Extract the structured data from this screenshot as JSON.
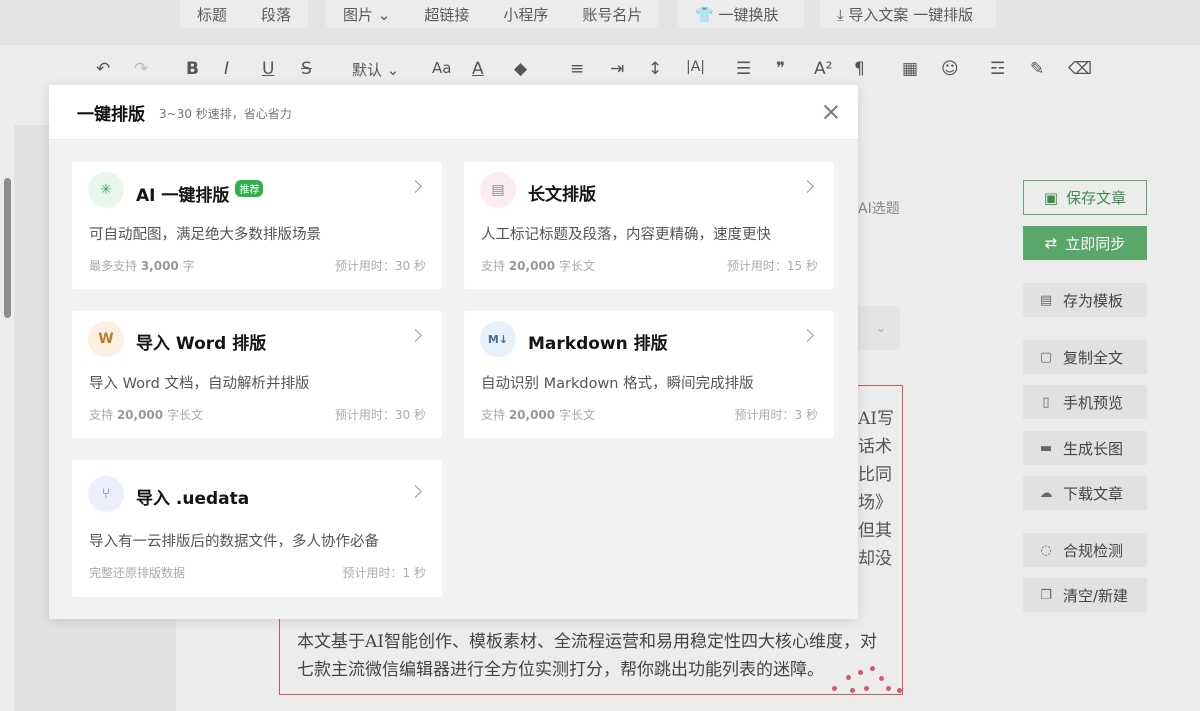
{
  "topbar": {
    "items": [
      {
        "label": "标题"
      },
      {
        "label": "段落"
      },
      {
        "label": "图片 ⌄"
      },
      {
        "label": "超链接"
      },
      {
        "label": "小程序"
      },
      {
        "label": "账号名片"
      },
      {
        "label": "一键换肤"
      },
      {
        "label": "导入文案 一键排版"
      }
    ]
  },
  "toolbar": {
    "font_select": "默认",
    "icons": [
      "undo-icon",
      "redo-icon",
      "bold-icon",
      "italic-icon",
      "underline-icon",
      "strikethrough-icon",
      "font-select",
      "font-size-icon",
      "font-color-icon",
      "highlight-icon",
      "align-icon",
      "indent-icon",
      "line-height-icon",
      "letter-spacing-icon",
      "list-icon",
      "quote-icon",
      "superscript-icon",
      "paragraph-icon",
      "table-icon",
      "emoji-icon",
      "divider-icon",
      "format-painter-icon",
      "eraser-icon"
    ]
  },
  "editor": {
    "ai_topic": "AI选题",
    "side_fragments": [
      "AI写",
      "话术",
      "比同",
      "场》",
      "但其",
      "却没"
    ],
    "body_lines": [
      "本文基于AI智能创作、模板素材、全流程运营和易用稳定性四大核心维度，对",
      "七款主流微信编辑器进行全方位实测打分，帮你跳出功能列表的迷障。"
    ]
  },
  "actions": {
    "save": "保存文章",
    "sync": "立即同步",
    "items": [
      {
        "label": "存为模板",
        "icon": "template-icon"
      },
      {
        "label": "复制全文",
        "icon": "copy-icon"
      },
      {
        "label": "手机预览",
        "icon": "phone-icon"
      },
      {
        "label": "生成长图",
        "icon": "long-image-icon"
      },
      {
        "label": "下载文章",
        "icon": "download-icon"
      },
      {
        "label": "合规检测",
        "icon": "compliance-icon"
      },
      {
        "label": "清空/新建",
        "icon": "clear-icon"
      }
    ]
  },
  "modal": {
    "title": "一键排版",
    "subtitle": "3~30 秒速排，省心省力",
    "cards": [
      {
        "title": "AI 一键排版",
        "badge": "推荐",
        "desc": "可自动配图，满足绝大多数排版场景",
        "foot_pre": "最多支持 ",
        "foot_num": "3,000",
        "foot_post": " 字",
        "time": "预计用时：30 秒",
        "icon": "ai-sparkle-icon",
        "icon_bg": "#e8f6ec",
        "icon_color": "#3aa85a"
      },
      {
        "title": "长文排版",
        "desc": "人工标记标题及段落，内容更精确，速度更快",
        "foot_pre": "支持 ",
        "foot_num": "20,000",
        "foot_post": " 字长文",
        "time": "预计用时：15 秒",
        "icon": "document-list-icon",
        "icon_bg": "#fdecef",
        "icon_color": "#888"
      },
      {
        "title": "导入 Word 排版",
        "desc": "导入 Word 文档，自动解析并排版",
        "foot_pre": "支持 ",
        "foot_num": "20,000",
        "foot_post": " 字长文",
        "time": "预计用时：30 秒",
        "icon": "word-icon",
        "icon_bg": "#fdf0e2",
        "icon_color": "#c07a2a"
      },
      {
        "title": "Markdown 排版",
        "desc": "自动识别 Markdown 格式，瞬间完成排版",
        "foot_pre": "支持 ",
        "foot_num": "20,000",
        "foot_post": " 字长文",
        "time": "预计用时：3 秒",
        "icon": "markdown-icon",
        "icon_bg": "#e6f1fb",
        "icon_color": "#4a6b8a"
      },
      {
        "title": "导入 .uedata",
        "desc": "导入有一云排版后的数据文件，多人协作必备",
        "foot_pre": "完整还原排版数据",
        "foot_num": "",
        "foot_post": "",
        "time": "预计用时：1 秒",
        "icon": "merge-icon",
        "icon_bg": "#eceefb",
        "icon_color": "#6a6fa8"
      }
    ]
  }
}
